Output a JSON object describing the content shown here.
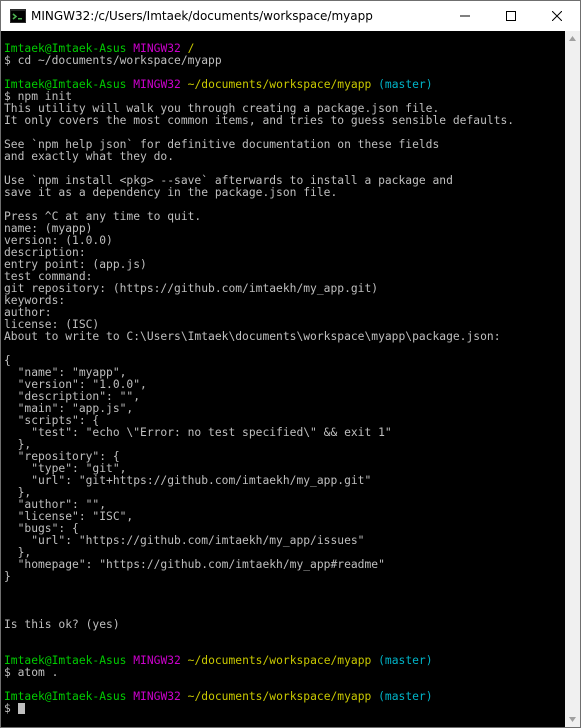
{
  "window": {
    "title": "MINGW32:/c/Users/Imtaek/documents/workspace/myapp"
  },
  "prompt": {
    "user_host": "Imtaek@Imtaek-Asus",
    "env": "MINGW32",
    "branch": "(master)"
  },
  "paths": {
    "home": "/",
    "project": "~/documents/workspace/myapp"
  },
  "commands": {
    "cd": "$ cd ~/documents/workspace/myapp",
    "npm_init": "$ npm init",
    "atom": "$ atom .",
    "empty": "$ "
  },
  "output": [
    "This utility will walk you through creating a package.json file.",
    "It only covers the most common items, and tries to guess sensible defaults.",
    "",
    "See `npm help json` for definitive documentation on these fields",
    "and exactly what they do.",
    "",
    "Use `npm install <pkg> --save` afterwards to install a package and",
    "save it as a dependency in the package.json file.",
    "",
    "Press ^C at any time to quit.",
    "name: (myapp)",
    "version: (1.0.0)",
    "description:",
    "entry point: (app.js)",
    "test command:",
    "git repository: (https://github.com/imtaekh/my_app.git)",
    "keywords:",
    "author:",
    "license: (ISC)",
    "About to write to C:\\Users\\Imtaek\\documents\\workspace\\myapp\\package.json:",
    "",
    "{",
    "  \"name\": \"myapp\",",
    "  \"version\": \"1.0.0\",",
    "  \"description\": \"\",",
    "  \"main\": \"app.js\",",
    "  \"scripts\": {",
    "    \"test\": \"echo \\\"Error: no test specified\\\" && exit 1\"",
    "  },",
    "  \"repository\": {",
    "    \"type\": \"git\",",
    "    \"url\": \"git+https://github.com/imtaekh/my_app.git\"",
    "  },",
    "  \"author\": \"\",",
    "  \"license\": \"ISC\",",
    "  \"bugs\": {",
    "    \"url\": \"https://github.com/imtaekh/my_app/issues\"",
    "  },",
    "  \"homepage\": \"https://github.com/imtaekh/my_app#readme\"",
    "}",
    "",
    "",
    "",
    "Is this ok? (yes)"
  ],
  "colors": {
    "user": "#00cc00",
    "env": "#cc00cc",
    "path": "#c8c800",
    "branch": "#00b4c8",
    "text": "#bfbfbf",
    "background": "#000000"
  },
  "icons": {
    "app": "mingw-app-icon",
    "minimize": "minimize-icon",
    "maximize": "maximize-icon",
    "close": "close-icon",
    "scroll_up": "scroll-up-arrow-icon",
    "scroll_down": "scroll-down-arrow-icon"
  }
}
